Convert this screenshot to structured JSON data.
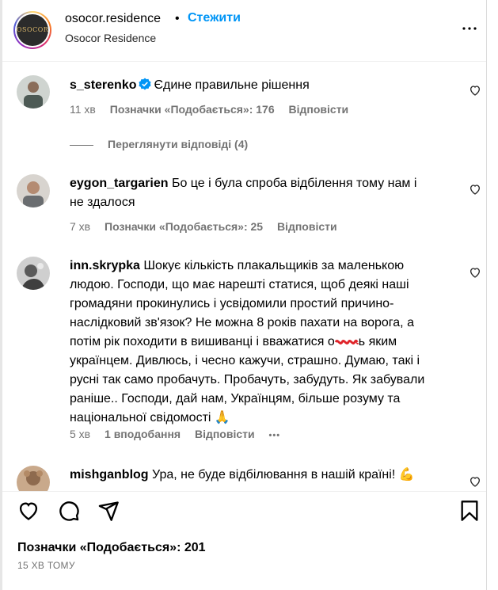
{
  "post": {
    "username": "osocor.residence",
    "separator": "•",
    "follow_label": "Стежити",
    "subtitle": "Osocor Residence",
    "logo_text": "OSOCOR"
  },
  "comments": [
    {
      "user": "s_sterenko",
      "verified": true,
      "text": "Єдине правильне рішення",
      "time": "11 хв",
      "likes": "Позначки «Подобається»: 176",
      "reply": "Відповісти"
    },
    {
      "user": "eygon_targarien",
      "text_lines": [
        "Бо це і була спроба відбілення тому нам і",
        "не здалося"
      ],
      "time": "7 хв",
      "likes": "Позначки «Подобається»: 25",
      "reply": "Відповісти"
    },
    {
      "user": "inn.skrypka",
      "first_line": "Шокує кількість плакальщиків за маленькою",
      "lines": [
        "людою. Господи, що має нарешті статися, щоб деякі наші",
        "громадяни прокинулись і усвідомили простий причино-",
        "наслідковий зв'язок? Не можна 8 років пахати на ворога, а",
        "потім рік походити в вишиванці і вважатися о",
        "українцем. Дивлюсь, і чесно кажучи, страшно. Думаю, такі і",
        "русні так само пробачуть. Пробачуть, забудуть. Як забували",
        "раніше.. Господи, дай нам, Українцям, більше розуму та",
        "національної свідомості 🙏"
      ],
      "line5_tail": "ь яким",
      "time": "5 хв",
      "likes": "1 вподобання",
      "reply": "Відповісти",
      "more": "•••"
    },
    {
      "user": "mishganblog",
      "text": "Ура, не буде відбілювання в нашій країні! 💪"
    }
  ],
  "view_replies": "Переглянути відповіді (4)",
  "footer": {
    "likes": "Позначки «Подобається»: 201",
    "time": "15 ХВ ТОМУ"
  },
  "colors": {
    "follow": "#0095f6",
    "verified": "#0095f6",
    "meta": "#737373",
    "scribble": "#e0252b"
  }
}
